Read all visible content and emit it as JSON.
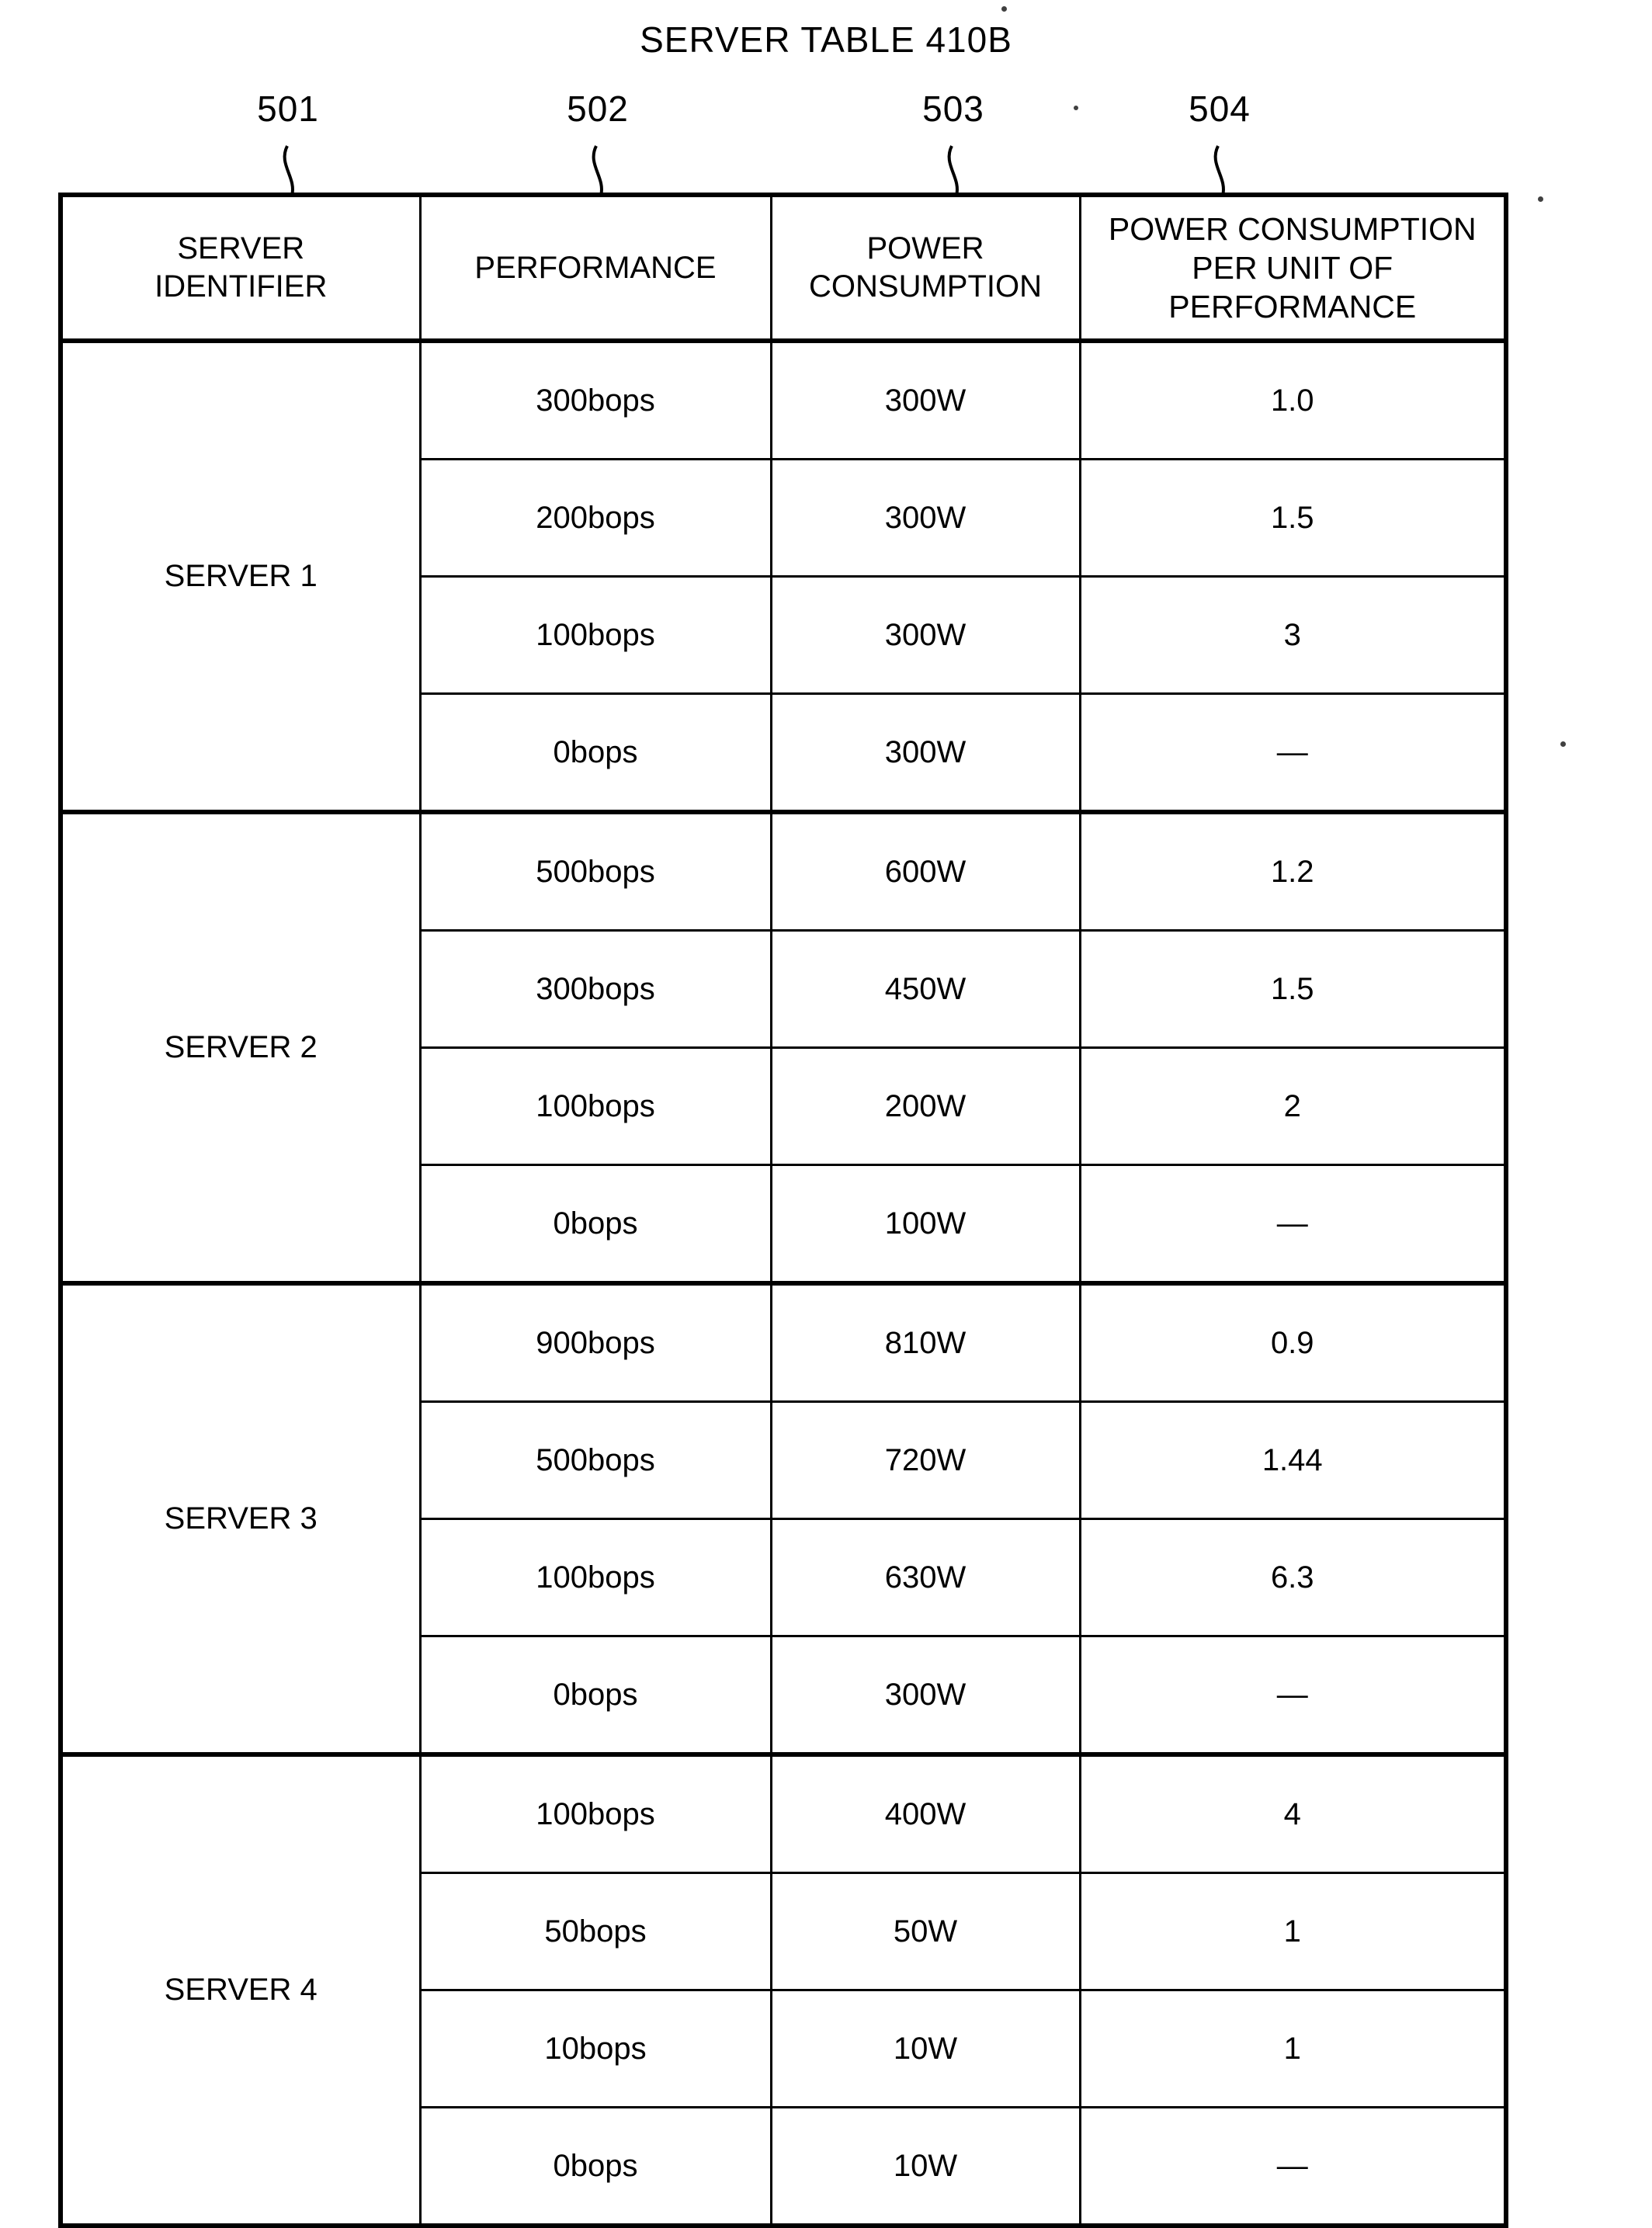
{
  "figure": {
    "title": "SERVER TABLE 410B",
    "reference_numerals": [
      {
        "label": "501",
        "target": "server-identifier-column"
      },
      {
        "label": "502",
        "target": "performance-column"
      },
      {
        "label": "503",
        "target": "power-consumption-column"
      },
      {
        "label": "504",
        "target": "power-consumption-per-unit-column"
      }
    ]
  },
  "table": {
    "headers": {
      "server_identifier": {
        "line1": "SERVER",
        "line2": "IDENTIFIER"
      },
      "performance": {
        "line1": "PERFORMANCE"
      },
      "power_consumption": {
        "line1": "POWER",
        "line2": "CONSUMPTION"
      },
      "power_consumption_per_unit": {
        "line1": "POWER CONSUMPTION",
        "line2": "PER UNIT OF",
        "line3": "PERFORMANCE"
      }
    },
    "columns": [
      "SERVER IDENTIFIER",
      "PERFORMANCE",
      "POWER CONSUMPTION",
      "POWER CONSUMPTION PER UNIT OF PERFORMANCE"
    ],
    "blocks": [
      {
        "server": "SERVER 1",
        "rows": [
          {
            "performance": "300bops",
            "power": "300W",
            "per_unit": "1.0"
          },
          {
            "performance": "200bops",
            "power": "300W",
            "per_unit": "1.5"
          },
          {
            "performance": "100bops",
            "power": "300W",
            "per_unit": "3"
          },
          {
            "performance": "0bops",
            "power": "300W",
            "per_unit": "—"
          }
        ]
      },
      {
        "server": "SERVER 2",
        "rows": [
          {
            "performance": "500bops",
            "power": "600W",
            "per_unit": "1.2"
          },
          {
            "performance": "300bops",
            "power": "450W",
            "per_unit": "1.5"
          },
          {
            "performance": "100bops",
            "power": "200W",
            "per_unit": "2"
          },
          {
            "performance": "0bops",
            "power": "100W",
            "per_unit": "—"
          }
        ]
      },
      {
        "server": "SERVER 3",
        "rows": [
          {
            "performance": "900bops",
            "power": "810W",
            "per_unit": "0.9"
          },
          {
            "performance": "500bops",
            "power": "720W",
            "per_unit": "1.44"
          },
          {
            "performance": "100bops",
            "power": "630W",
            "per_unit": "6.3"
          },
          {
            "performance": "0bops",
            "power": "300W",
            "per_unit": "—"
          }
        ]
      },
      {
        "server": "SERVER 4",
        "rows": [
          {
            "performance": "100bops",
            "power": "400W",
            "per_unit": "4"
          },
          {
            "performance": "50bops",
            "power": "50W",
            "per_unit": "1"
          },
          {
            "performance": "10bops",
            "power": "10W",
            "per_unit": "1"
          },
          {
            "performance": "0bops",
            "power": "10W",
            "per_unit": "—"
          }
        ]
      }
    ]
  }
}
